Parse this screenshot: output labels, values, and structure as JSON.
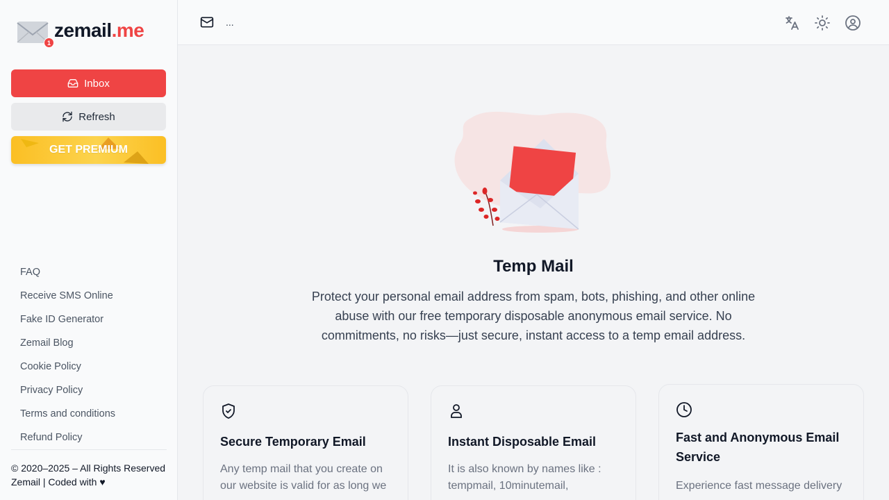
{
  "sidebar": {
    "logo": {
      "name": "zemail",
      "suffix": ".me",
      "badge": "1"
    },
    "buttons": {
      "inbox": "Inbox",
      "refresh": "Refresh",
      "premium": "GET PREMIUM"
    },
    "links": [
      "FAQ",
      "Receive SMS Online",
      "Fake ID Generator",
      "Zemail Blog",
      "Cookie Policy",
      "Privacy Policy",
      "Terms and conditions",
      "Refund Policy"
    ],
    "copyright_line1": "© 2020–2025 – All Rights Reserved",
    "copyright_line2": "Zemail | Coded with ♥"
  },
  "header": {
    "email_placeholder": "...",
    "icons": [
      "mail-icon",
      "translate-icon",
      "sun-icon",
      "user-circle-icon"
    ]
  },
  "hero": {
    "title": "Temp Mail",
    "description": "Protect your personal email address from spam, bots, phishing, and other online abuse with our free temporary disposable anonymous email service. No commitments, no risks—just secure, instant access to a temp email address."
  },
  "cards": [
    {
      "icon": "shield-check-icon",
      "title": "Secure Temporary Email",
      "text": "Any temp mail that you create on our website is valid for as long we"
    },
    {
      "icon": "user-icon",
      "title": "Instant Disposable Email",
      "text": "It is also known by names like : tempmail, 10minutemail,"
    },
    {
      "icon": "clock-icon",
      "title": "Fast and Anonymous Email Service",
      "text": "Experience fast message delivery"
    }
  ],
  "colors": {
    "accent": "#ef4444",
    "premium": "#fbbf24",
    "sidebar_bg": "#f9fafb",
    "main_bg": "#f3f4f6"
  }
}
